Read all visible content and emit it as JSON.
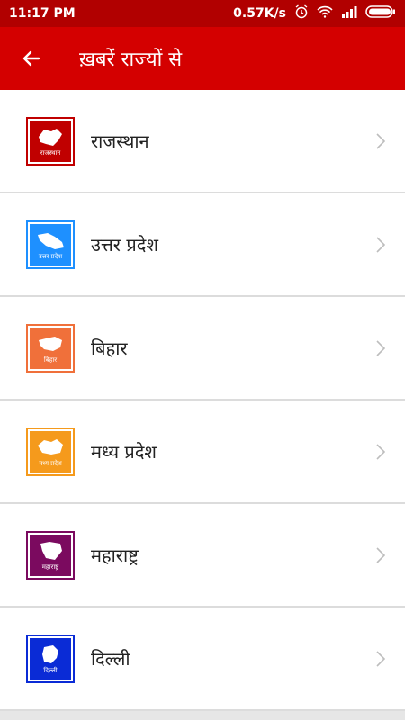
{
  "status_bar": {
    "time": "11:17 PM",
    "speed": "0.57K/s",
    "icons": [
      "alarm-icon",
      "wifi-icon",
      "signal-icon",
      "battery-icon"
    ]
  },
  "app_bar": {
    "title": "ख़बरें राज्यों से",
    "back_icon": "arrow-left-icon"
  },
  "states": [
    {
      "name": "राजस्थान",
      "badge_text": "राजस्थान",
      "color": "#c00000"
    },
    {
      "name": "उत्तर प्रदेश",
      "badge_text": "उत्तर प्रदेश",
      "color": "#1e90ff"
    },
    {
      "name": "बिहार",
      "badge_text": "बिहार",
      "color": "#f0703a"
    },
    {
      "name": "मध्य प्रदेश",
      "badge_text": "मध्य प्रदेश",
      "color": "#f59a1c"
    },
    {
      "name": "महाराष्ट्र",
      "badge_text": "महाराष्ट्र",
      "color": "#7b0a5f"
    },
    {
      "name": "दिल्ली",
      "badge_text": "दिल्ली",
      "color": "#0a2bd6"
    }
  ]
}
